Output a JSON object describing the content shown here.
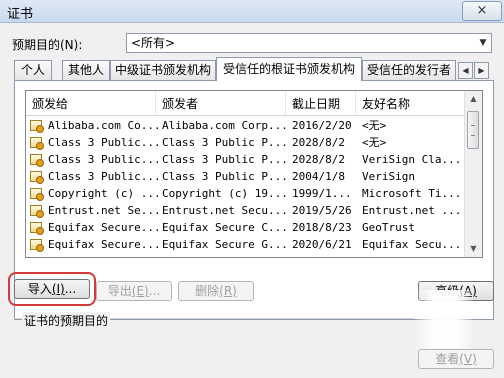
{
  "window": {
    "title": "证书",
    "close_label": "×"
  },
  "purpose": {
    "label": "预期目的(N):",
    "selected": "<所有>"
  },
  "tabs": [
    {
      "label": "个人"
    },
    {
      "label": "其他人"
    },
    {
      "label": "中级证书颁发机构"
    },
    {
      "label": "受信任的根证书颁发机构"
    },
    {
      "label": "受信任的发行者"
    }
  ],
  "table": {
    "columns": [
      "颁发给",
      "颁发者",
      "截止日期",
      "友好名称"
    ],
    "rows": [
      [
        "Alibaba.com Co...",
        "Alibaba.com Corp...",
        "2016/2/20",
        "<无>"
      ],
      [
        "Class 3 Public...",
        "Class 3 Public P...",
        "2028/8/2",
        "<无>"
      ],
      [
        "Class 3 Public...",
        "Class 3 Public P...",
        "2028/8/2",
        "VeriSign Cla..."
      ],
      [
        "Class 3 Public...",
        "Class 3 Public P...",
        "2004/1/8",
        "VeriSign"
      ],
      [
        "Copyright (c) ...",
        "Copyright (c) 19...",
        "1999/1...",
        "Microsoft Ti..."
      ],
      [
        "Entrust.net Se...",
        "Entrust.net Secu...",
        "2019/5/26",
        "Entrust.net ..."
      ],
      [
        "Equifax Secure...",
        "Equifax Secure C...",
        "2018/8/23",
        "GeoTrust"
      ],
      [
        "Equifax Secure...",
        "Equifax Secure G...",
        "2020/6/21",
        "Equifax Secu..."
      ]
    ]
  },
  "buttons": {
    "import": {
      "label": "导入",
      "key": "(I)",
      "suffix": "..."
    },
    "export": {
      "label": "导出",
      "key": "(E)",
      "suffix": "..."
    },
    "remove": {
      "label": "删除",
      "key": "(R)"
    },
    "advanced": {
      "label": "高级",
      "key": "(A)"
    },
    "view": {
      "label": "查看",
      "key": "(V)"
    }
  },
  "purpose_group": {
    "label": "证书的预期目的"
  },
  "colors": {
    "highlight": "#d23b3b"
  }
}
